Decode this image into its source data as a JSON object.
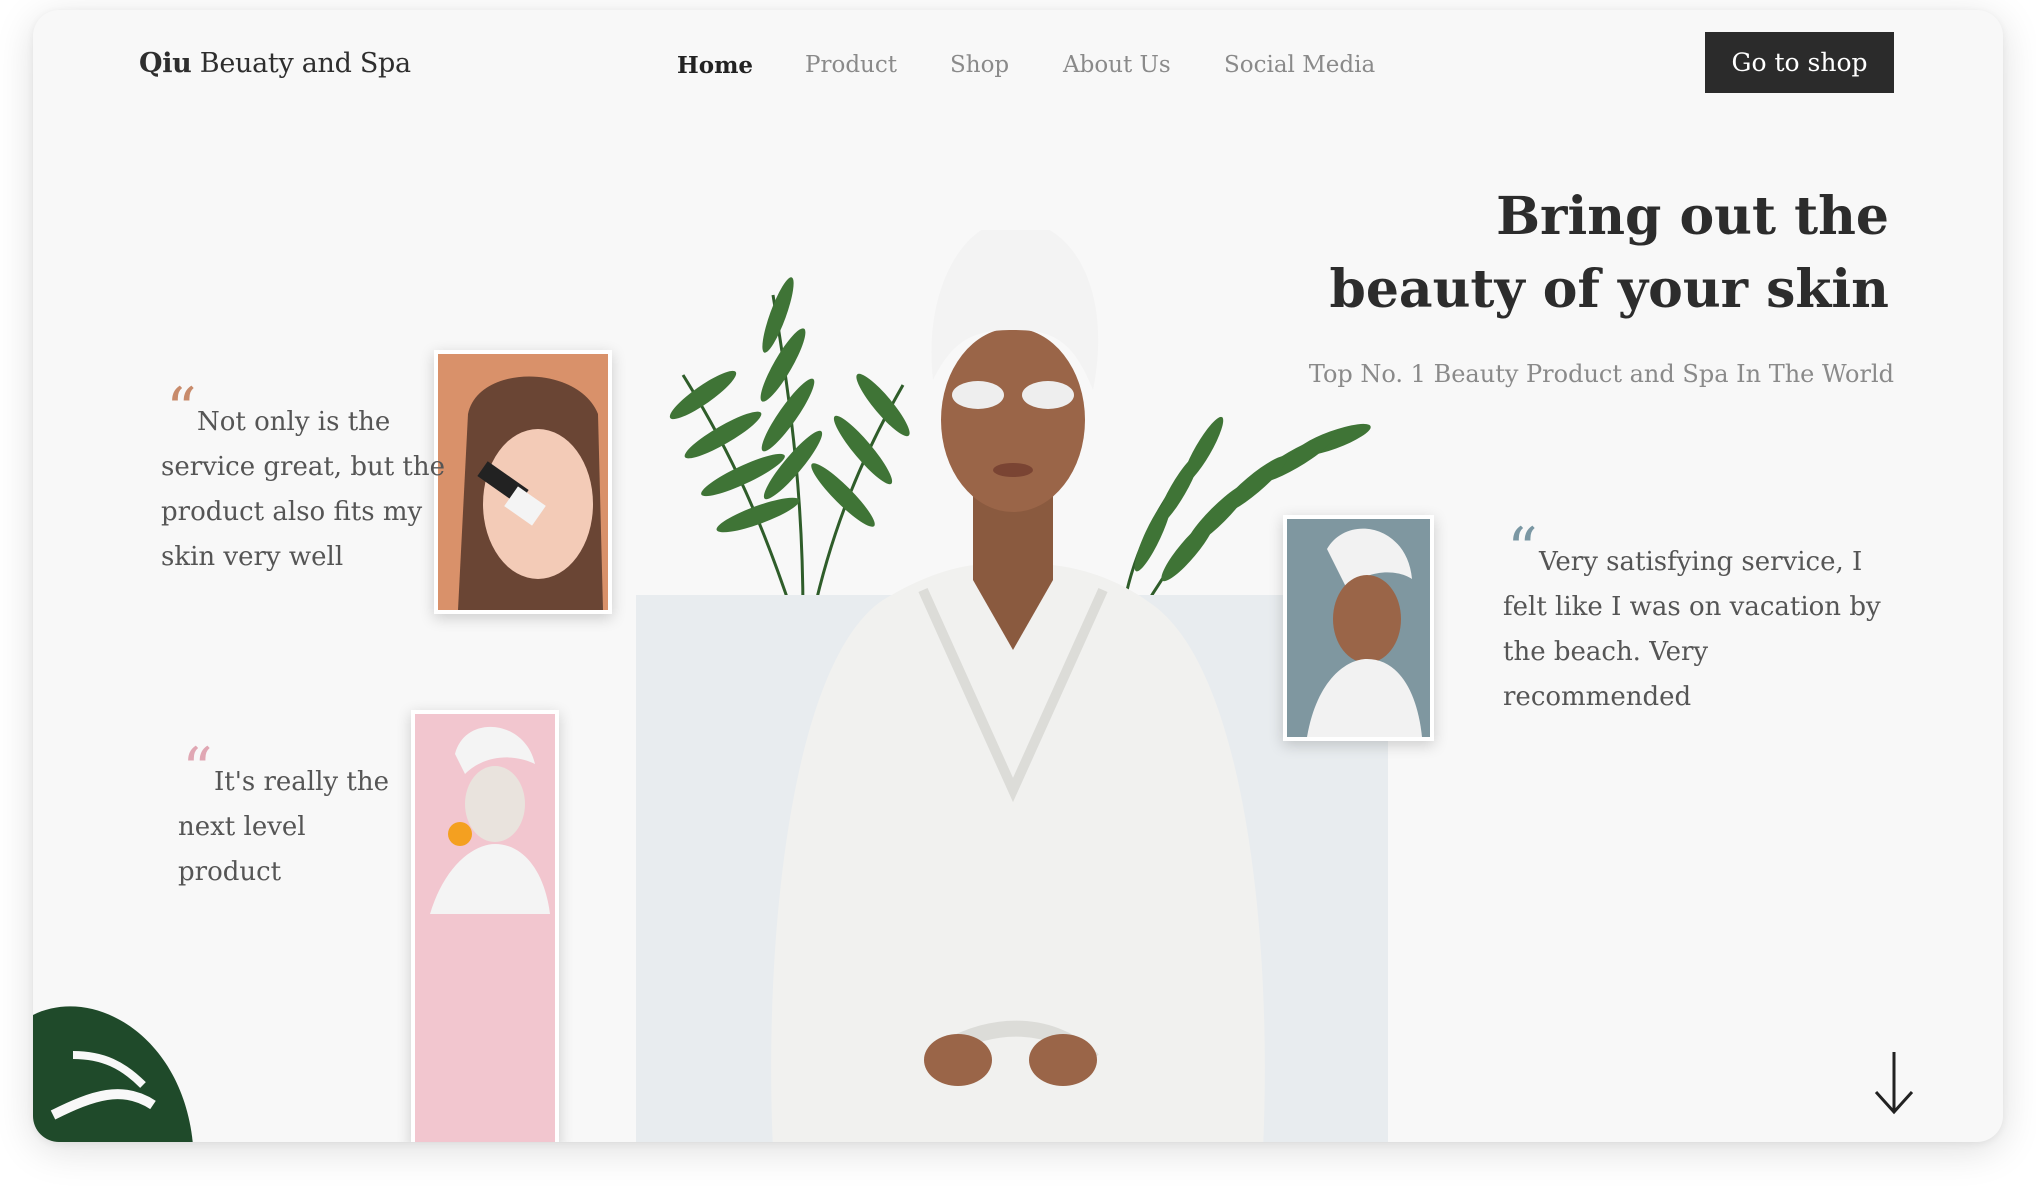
{
  "brand": {
    "bold": "Qiu",
    "rest": " Beuaty and Spa"
  },
  "nav": {
    "items": [
      {
        "label": "Home",
        "active": true
      },
      {
        "label": "Product",
        "active": false
      },
      {
        "label": "Shop",
        "active": false
      },
      {
        "label": "About Us",
        "active": false
      },
      {
        "label": "Social Media",
        "active": false
      }
    ],
    "cta_label": "Go to shop"
  },
  "hero": {
    "title_line1": "Bring out the",
    "title_line2": "beauty of your skin",
    "subtitle": "Top No. 1 Beauty Product and Spa In The World"
  },
  "testimonials": [
    {
      "text": "Not only is the service great, but the product also fits my skin very well",
      "quote_color": "#c88b6b"
    },
    {
      "text": "Very satisfying service, I felt like I was on vacation by the beach. Very recommended",
      "quote_color": "#7a97a3"
    },
    {
      "text": "It's really the next level product",
      "quote_color": "#e0a7b3"
    }
  ],
  "quote_glyph": "“",
  "icons": {
    "scroll": "arrow-down-icon"
  },
  "colors": {
    "background": "#f8f8f8",
    "cta": "#2b2b2b",
    "panel": "#e8ecef"
  }
}
